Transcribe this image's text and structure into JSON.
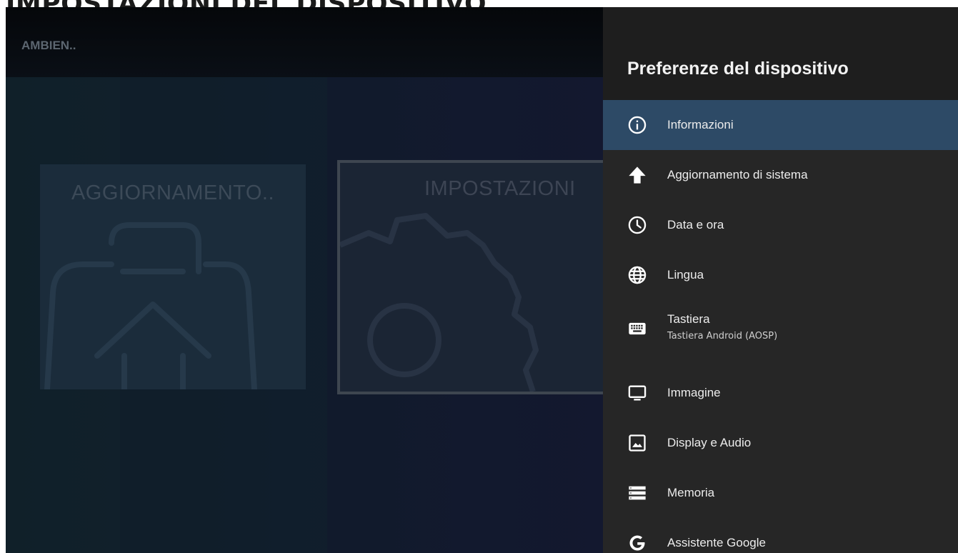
{
  "page": {
    "heading": "IMPOSTAZIONI DEL DISPOSITIVO"
  },
  "background": {
    "ambient_label": "AMBIEN..",
    "tiles": [
      {
        "title": "AGGIORNAMENTO..",
        "icon": "update-bag-icon"
      },
      {
        "title": "IMPOSTAZIONI",
        "icon": "gear-icon"
      }
    ]
  },
  "panel": {
    "title": "Preferenze del dispositivo",
    "items": [
      {
        "label": "Informazioni",
        "icon": "info-icon",
        "selected": true
      },
      {
        "label": "Aggiornamento di sistema",
        "icon": "arrow-up-icon"
      },
      {
        "label": "Data e ora",
        "icon": "clock-icon"
      },
      {
        "label": "Lingua",
        "icon": "globe-icon"
      },
      {
        "label": "Tastiera",
        "sublabel": "Tastiera Android (AOSP)",
        "icon": "keyboard-icon"
      },
      {
        "label": "Immagine",
        "icon": "monitor-icon"
      },
      {
        "label": "Display e Audio",
        "icon": "image-icon"
      },
      {
        "label": "Memoria",
        "icon": "storage-icon"
      },
      {
        "label": "Assistente Google",
        "icon": "google-icon"
      }
    ]
  },
  "colors": {
    "panel_bg": "#262626",
    "panel_header_bg": "#1e1e1e",
    "selected_bg": "#2d4a66",
    "text": "#ececec"
  }
}
